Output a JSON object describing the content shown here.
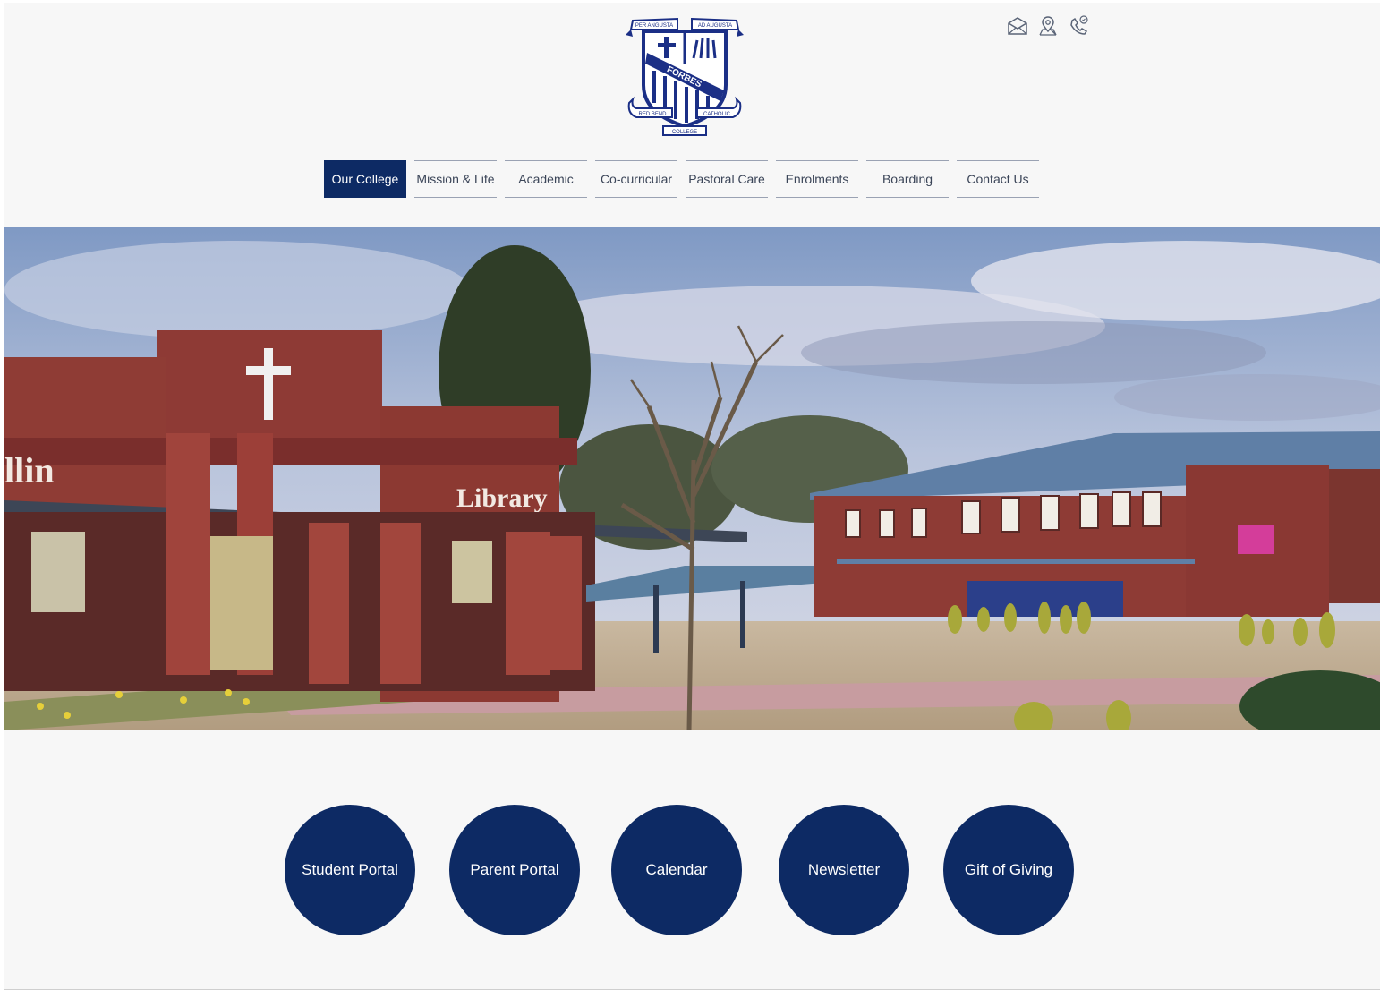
{
  "header": {
    "crest": {
      "motto_left": "PER ANGUSTA",
      "motto_right": "AD AUGUSTA",
      "band": "FORBES",
      "scroll_left": "RED BEND",
      "scroll_right": "CATHOLIC",
      "scroll_bottom": "COLLEGE"
    },
    "icons": [
      "mail-icon",
      "location-pin-icon",
      "phone-icon"
    ]
  },
  "nav": {
    "items": [
      {
        "label": "Our College",
        "active": true
      },
      {
        "label": "Mission & Life",
        "active": false
      },
      {
        "label": "Academic",
        "active": false
      },
      {
        "label": "Co-curricular",
        "active": false
      },
      {
        "label": "Pastoral Care",
        "active": false
      },
      {
        "label": "Enrolments",
        "active": false
      },
      {
        "label": "Boarding",
        "active": false
      },
      {
        "label": "Contact Us",
        "active": false
      }
    ]
  },
  "hero": {
    "signs": {
      "building": "llin",
      "library": "Library"
    }
  },
  "quick_links": [
    {
      "label": "Student Portal"
    },
    {
      "label": "Parent Portal"
    },
    {
      "label": "Calendar"
    },
    {
      "label": "Newsletter"
    },
    {
      "label": "Gift of Giving"
    }
  ],
  "colors": {
    "brand_navy": "#0d2a64",
    "page_bg": "#f7f7f7",
    "nav_text": "#3b4558"
  }
}
